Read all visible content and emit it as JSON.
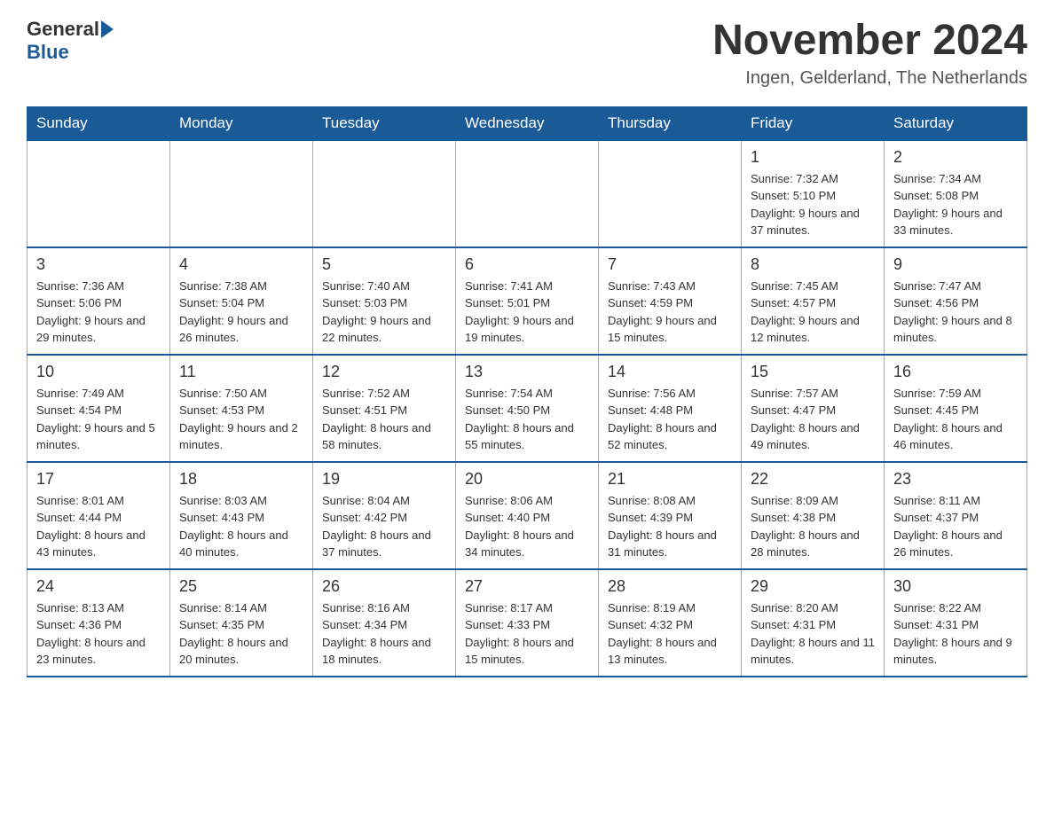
{
  "header": {
    "logo_text_general": "General",
    "logo_text_blue": "Blue",
    "month_title": "November 2024",
    "subtitle": "Ingen, Gelderland, The Netherlands"
  },
  "days_of_week": [
    "Sunday",
    "Monday",
    "Tuesday",
    "Wednesday",
    "Thursday",
    "Friday",
    "Saturday"
  ],
  "weeks": [
    [
      {
        "day": "",
        "info": ""
      },
      {
        "day": "",
        "info": ""
      },
      {
        "day": "",
        "info": ""
      },
      {
        "day": "",
        "info": ""
      },
      {
        "day": "",
        "info": ""
      },
      {
        "day": "1",
        "info": "Sunrise: 7:32 AM\nSunset: 5:10 PM\nDaylight: 9 hours and 37 minutes."
      },
      {
        "day": "2",
        "info": "Sunrise: 7:34 AM\nSunset: 5:08 PM\nDaylight: 9 hours and 33 minutes."
      }
    ],
    [
      {
        "day": "3",
        "info": "Sunrise: 7:36 AM\nSunset: 5:06 PM\nDaylight: 9 hours and 29 minutes."
      },
      {
        "day": "4",
        "info": "Sunrise: 7:38 AM\nSunset: 5:04 PM\nDaylight: 9 hours and 26 minutes."
      },
      {
        "day": "5",
        "info": "Sunrise: 7:40 AM\nSunset: 5:03 PM\nDaylight: 9 hours and 22 minutes."
      },
      {
        "day": "6",
        "info": "Sunrise: 7:41 AM\nSunset: 5:01 PM\nDaylight: 9 hours and 19 minutes."
      },
      {
        "day": "7",
        "info": "Sunrise: 7:43 AM\nSunset: 4:59 PM\nDaylight: 9 hours and 15 minutes."
      },
      {
        "day": "8",
        "info": "Sunrise: 7:45 AM\nSunset: 4:57 PM\nDaylight: 9 hours and 12 minutes."
      },
      {
        "day": "9",
        "info": "Sunrise: 7:47 AM\nSunset: 4:56 PM\nDaylight: 9 hours and 8 minutes."
      }
    ],
    [
      {
        "day": "10",
        "info": "Sunrise: 7:49 AM\nSunset: 4:54 PM\nDaylight: 9 hours and 5 minutes."
      },
      {
        "day": "11",
        "info": "Sunrise: 7:50 AM\nSunset: 4:53 PM\nDaylight: 9 hours and 2 minutes."
      },
      {
        "day": "12",
        "info": "Sunrise: 7:52 AM\nSunset: 4:51 PM\nDaylight: 8 hours and 58 minutes."
      },
      {
        "day": "13",
        "info": "Sunrise: 7:54 AM\nSunset: 4:50 PM\nDaylight: 8 hours and 55 minutes."
      },
      {
        "day": "14",
        "info": "Sunrise: 7:56 AM\nSunset: 4:48 PM\nDaylight: 8 hours and 52 minutes."
      },
      {
        "day": "15",
        "info": "Sunrise: 7:57 AM\nSunset: 4:47 PM\nDaylight: 8 hours and 49 minutes."
      },
      {
        "day": "16",
        "info": "Sunrise: 7:59 AM\nSunset: 4:45 PM\nDaylight: 8 hours and 46 minutes."
      }
    ],
    [
      {
        "day": "17",
        "info": "Sunrise: 8:01 AM\nSunset: 4:44 PM\nDaylight: 8 hours and 43 minutes."
      },
      {
        "day": "18",
        "info": "Sunrise: 8:03 AM\nSunset: 4:43 PM\nDaylight: 8 hours and 40 minutes."
      },
      {
        "day": "19",
        "info": "Sunrise: 8:04 AM\nSunset: 4:42 PM\nDaylight: 8 hours and 37 minutes."
      },
      {
        "day": "20",
        "info": "Sunrise: 8:06 AM\nSunset: 4:40 PM\nDaylight: 8 hours and 34 minutes."
      },
      {
        "day": "21",
        "info": "Sunrise: 8:08 AM\nSunset: 4:39 PM\nDaylight: 8 hours and 31 minutes."
      },
      {
        "day": "22",
        "info": "Sunrise: 8:09 AM\nSunset: 4:38 PM\nDaylight: 8 hours and 28 minutes."
      },
      {
        "day": "23",
        "info": "Sunrise: 8:11 AM\nSunset: 4:37 PM\nDaylight: 8 hours and 26 minutes."
      }
    ],
    [
      {
        "day": "24",
        "info": "Sunrise: 8:13 AM\nSunset: 4:36 PM\nDaylight: 8 hours and 23 minutes."
      },
      {
        "day": "25",
        "info": "Sunrise: 8:14 AM\nSunset: 4:35 PM\nDaylight: 8 hours and 20 minutes."
      },
      {
        "day": "26",
        "info": "Sunrise: 8:16 AM\nSunset: 4:34 PM\nDaylight: 8 hours and 18 minutes."
      },
      {
        "day": "27",
        "info": "Sunrise: 8:17 AM\nSunset: 4:33 PM\nDaylight: 8 hours and 15 minutes."
      },
      {
        "day": "28",
        "info": "Sunrise: 8:19 AM\nSunset: 4:32 PM\nDaylight: 8 hours and 13 minutes."
      },
      {
        "day": "29",
        "info": "Sunrise: 8:20 AM\nSunset: 4:31 PM\nDaylight: 8 hours and 11 minutes."
      },
      {
        "day": "30",
        "info": "Sunrise: 8:22 AM\nSunset: 4:31 PM\nDaylight: 8 hours and 9 minutes."
      }
    ]
  ]
}
